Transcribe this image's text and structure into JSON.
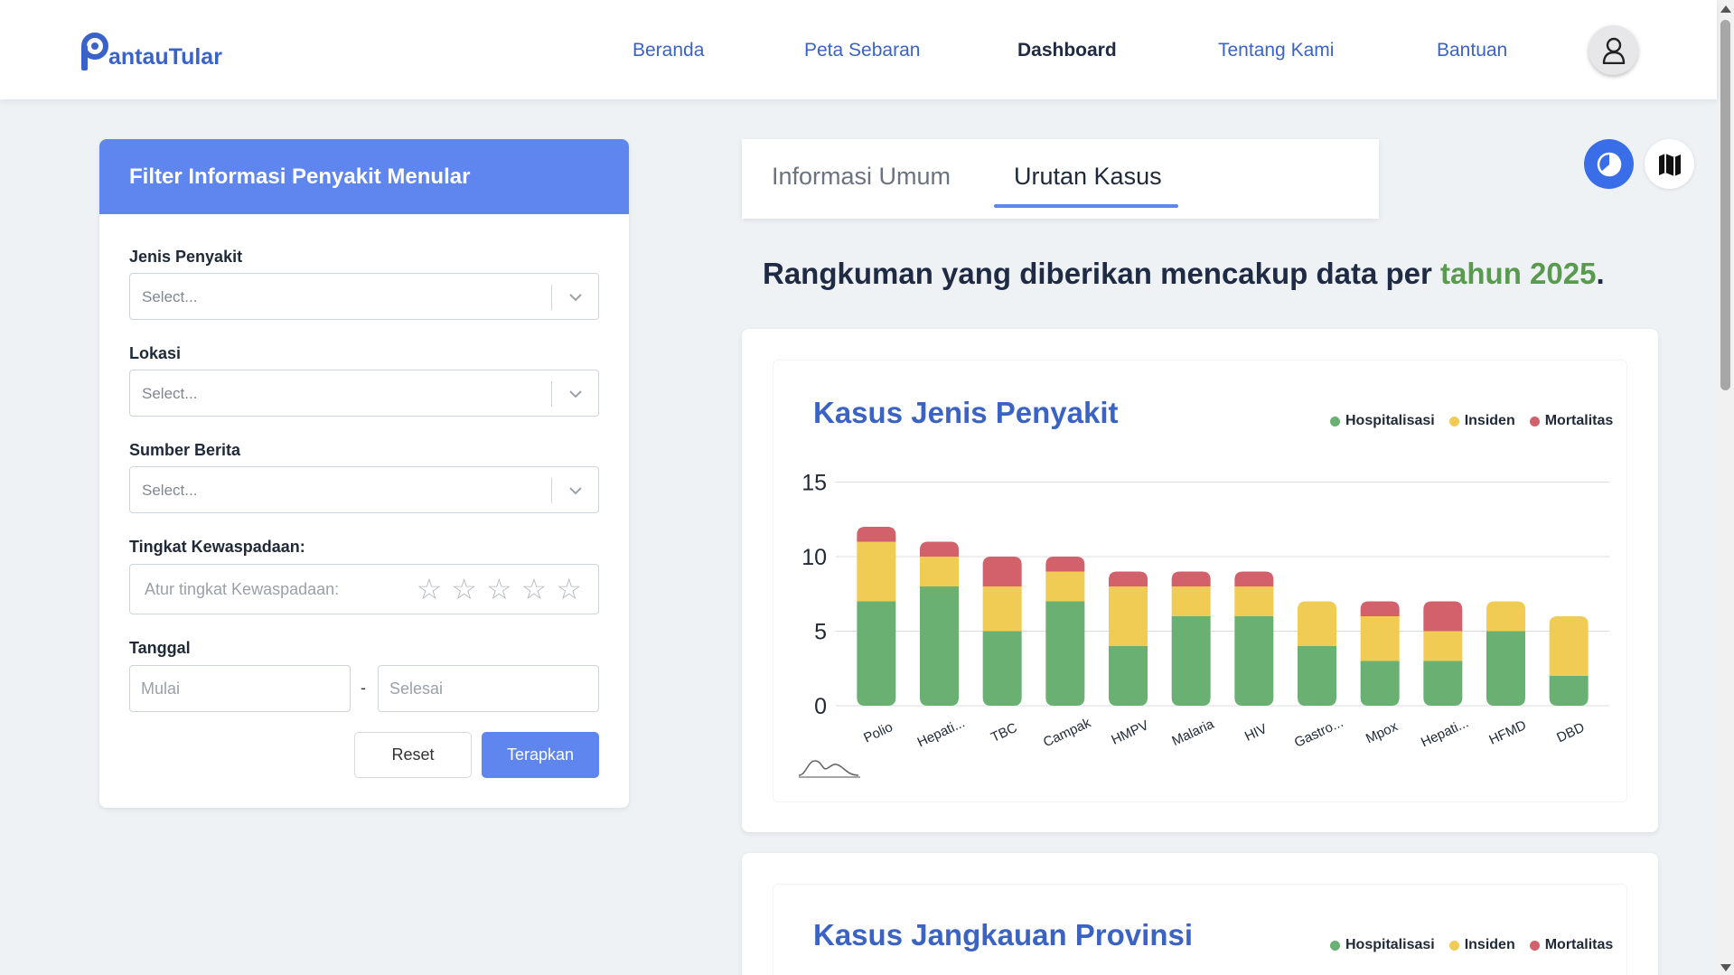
{
  "header": {
    "logo_text": "antauTular",
    "nav": [
      "Beranda",
      "Peta Sebaran",
      "Dashboard",
      "Tentang Kami",
      "Bantuan"
    ],
    "active_nav": "Dashboard"
  },
  "filter": {
    "title": "Filter Informasi Penyakit Menular",
    "jenis_label": "Jenis Penyakit",
    "jenis_placeholder": "Select...",
    "lokasi_label": "Lokasi",
    "lokasi_placeholder": "Select...",
    "sumber_label": "Sumber Berita",
    "sumber_placeholder": "Select...",
    "kewaspadaan_label": "Tingkat Kewaspadaan:",
    "kewaspadaan_placeholder": "Atur tingkat Kewaspadaan:",
    "stars": 0,
    "tanggal_label": "Tanggal",
    "mulai_placeholder": "Mulai",
    "selesai_placeholder": "Selesai",
    "date_separator": "-",
    "reset_label": "Reset",
    "apply_label": "Terapkan"
  },
  "tabs": [
    "Informasi Umum",
    "Urutan Kasus"
  ],
  "active_tab": "Urutan Kasus",
  "summary": {
    "text": "Rangkuman yang diberikan mencakup data per ",
    "year_text": "tahun 2025",
    "end": "."
  },
  "colors": {
    "hospitalisasi": "#6bb073",
    "insiden": "#f0cc55",
    "mortalitas": "#d2616b",
    "accent": "#5f86ee"
  },
  "chart_data": [
    {
      "type": "bar",
      "stacked": true,
      "title": "Kasus Jenis Penyakit",
      "categories": [
        "Polio",
        "Hepati...",
        "TBC",
        "Campak",
        "HMPV",
        "Malaria",
        "HIV",
        "Gastro...",
        "Mpox",
        "Hepati...",
        "HFMD",
        "DBD"
      ],
      "series": [
        {
          "name": "Hospitalisasi",
          "values": [
            7,
            8,
            5,
            7,
            4,
            6,
            6,
            4,
            3,
            3,
            5,
            2
          ]
        },
        {
          "name": "Insiden",
          "values": [
            4,
            2,
            3,
            2,
            4,
            2,
            2,
            3,
            3,
            2,
            2,
            4
          ]
        },
        {
          "name": "Mortalitas",
          "values": [
            1,
            1,
            2,
            1,
            1,
            1,
            1,
            0,
            1,
            2,
            0,
            0
          ]
        }
      ],
      "yticks": [
        0,
        5,
        10,
        15
      ],
      "ylim": [
        0,
        15
      ],
      "grid": true,
      "legend": "top-right"
    },
    {
      "type": "bar",
      "stacked": true,
      "title": "Kasus Jangkauan Provinsi",
      "series": [
        {
          "name": "Hospitalisasi"
        },
        {
          "name": "Insiden"
        },
        {
          "name": "Mortalitas"
        }
      ],
      "legend": "top-right"
    }
  ]
}
